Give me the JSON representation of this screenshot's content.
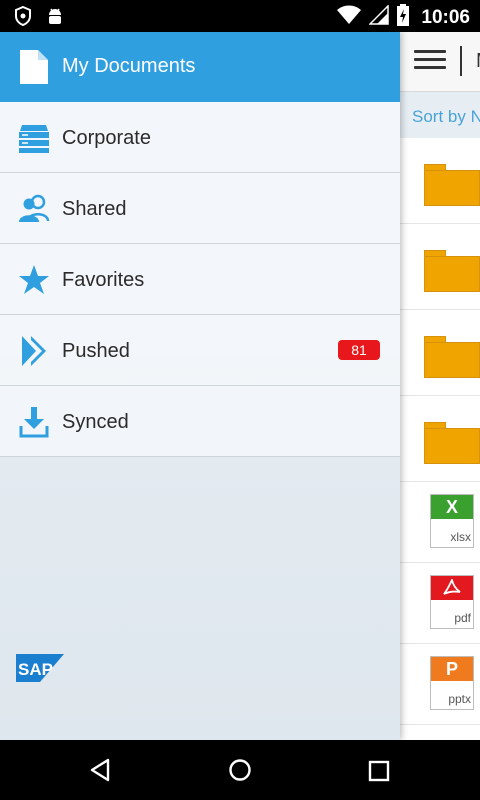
{
  "status_bar": {
    "time": "10:06",
    "icons": [
      "shield-icon",
      "android-icon",
      "wifi-icon",
      "signal-icon",
      "battery-charging-icon"
    ]
  },
  "main": {
    "toolbar": {
      "title": "M",
      "menu_icon": "hamburger-icon"
    },
    "sort_label": "Sort by N",
    "files": [
      {
        "type": "folder"
      },
      {
        "type": "folder"
      },
      {
        "type": "folder"
      },
      {
        "type": "folder"
      },
      {
        "type": "xlsx",
        "letter": "X",
        "ext": "xlsx",
        "color": "#3aa12e"
      },
      {
        "type": "pdf",
        "letter": "",
        "ext": "pdf",
        "color": "#e2191f"
      },
      {
        "type": "pptx",
        "letter": "P",
        "ext": "pptx",
        "color": "#f07b1f"
      }
    ]
  },
  "drawer": {
    "header": {
      "title": "My Documents",
      "icon": "document-icon"
    },
    "items": [
      {
        "label": "Corporate",
        "icon": "server-icon"
      },
      {
        "label": "Shared",
        "icon": "people-icon"
      },
      {
        "label": "Favorites",
        "icon": "star-icon"
      },
      {
        "label": "Pushed",
        "icon": "push-icon",
        "badge": "81"
      },
      {
        "label": "Synced",
        "icon": "download-icon"
      }
    ],
    "logo": "SAP"
  },
  "colors": {
    "accent": "#2f9fe0",
    "badge": "#e8171b",
    "folder": "#f0a400"
  }
}
